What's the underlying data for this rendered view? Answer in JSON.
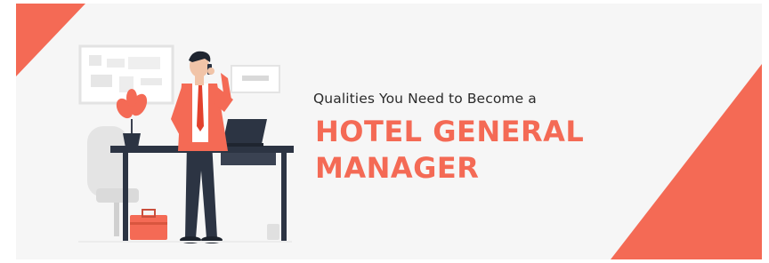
{
  "banner": {
    "subtitle": "Qualities You Need to Become a",
    "headline_line1": "HOTEL GENERAL",
    "headline_line2": "MANAGER"
  },
  "colors": {
    "accent": "#f46a55",
    "dark_text": "#2b2b2b",
    "navy": "#2c3443",
    "background": "#f6f6f6"
  },
  "illustration": {
    "subject": "man-on-phone-at-desk-with-laptop",
    "elements": [
      "whiteboard-icon",
      "wall-sign-icon",
      "potted-plant-icon",
      "chair-icon",
      "laptop-icon",
      "briefcase-icon",
      "desk-icon"
    ]
  }
}
